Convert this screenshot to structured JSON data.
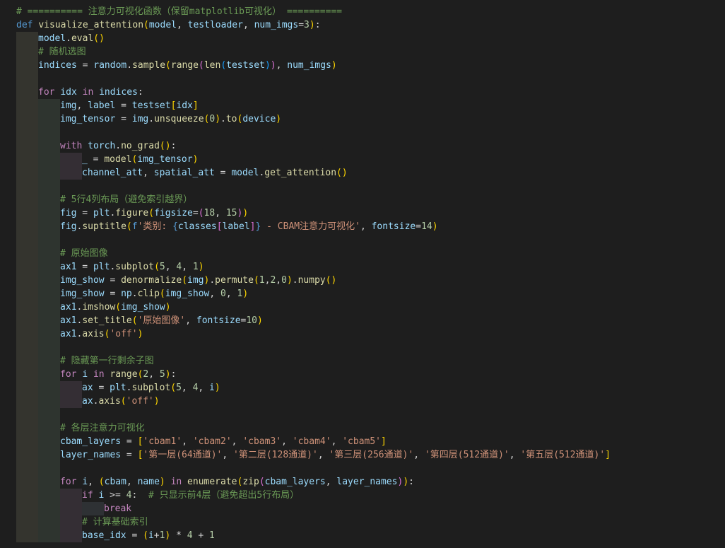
{
  "editor": {
    "theme": "dark",
    "background": "#1e1e1e",
    "language": "python"
  },
  "lines": [
    {
      "indent": 0,
      "tokens": [
        [
          "# ========== 注意力可视化函数（保留matplotlib可视化） ==========",
          "comment"
        ]
      ]
    },
    {
      "indent": 0,
      "tokens": [
        [
          "def",
          "kw"
        ],
        [
          " ",
          "op"
        ],
        [
          "visualize_attention",
          "fn"
        ],
        [
          "(",
          "b1"
        ],
        [
          "model",
          "var"
        ],
        [
          ", ",
          "op"
        ],
        [
          "testloader",
          "var"
        ],
        [
          ", ",
          "op"
        ],
        [
          "num_imgs",
          "var"
        ],
        [
          "=",
          "op"
        ],
        [
          "3",
          "num"
        ],
        [
          ")",
          "b1"
        ],
        [
          ":",
          "op"
        ]
      ]
    },
    {
      "indent": 1,
      "tokens": [
        [
          "model",
          "var"
        ],
        [
          ".",
          "op"
        ],
        [
          "eval",
          "fn"
        ],
        [
          "()",
          "b1"
        ]
      ]
    },
    {
      "indent": 1,
      "tokens": [
        [
          "# 随机选图",
          "comment"
        ]
      ]
    },
    {
      "indent": 1,
      "tokens": [
        [
          "indices",
          "var"
        ],
        [
          " = ",
          "op"
        ],
        [
          "random",
          "var"
        ],
        [
          ".",
          "op"
        ],
        [
          "sample",
          "fn"
        ],
        [
          "(",
          "b1"
        ],
        [
          "range",
          "fn"
        ],
        [
          "(",
          "b2"
        ],
        [
          "len",
          "fn"
        ],
        [
          "(",
          "b3"
        ],
        [
          "testset",
          "var"
        ],
        [
          ")",
          "b3"
        ],
        [
          ")",
          "b2"
        ],
        [
          ", ",
          "op"
        ],
        [
          "num_imgs",
          "var"
        ],
        [
          ")",
          "b1"
        ]
      ]
    },
    {
      "indent": 1,
      "tokens": []
    },
    {
      "indent": 1,
      "tokens": [
        [
          "for",
          "ctrl"
        ],
        [
          " ",
          "op"
        ],
        [
          "idx",
          "var"
        ],
        [
          " ",
          "op"
        ],
        [
          "in",
          "ctrl"
        ],
        [
          " ",
          "op"
        ],
        [
          "indices",
          "var"
        ],
        [
          ":",
          "op"
        ]
      ]
    },
    {
      "indent": 2,
      "tokens": [
        [
          "img",
          "var"
        ],
        [
          ", ",
          "op"
        ],
        [
          "label",
          "var"
        ],
        [
          " = ",
          "op"
        ],
        [
          "testset",
          "var"
        ],
        [
          "[",
          "b1"
        ],
        [
          "idx",
          "var"
        ],
        [
          "]",
          "b1"
        ]
      ]
    },
    {
      "indent": 2,
      "tokens": [
        [
          "img_tensor",
          "var"
        ],
        [
          " = ",
          "op"
        ],
        [
          "img",
          "var"
        ],
        [
          ".",
          "op"
        ],
        [
          "unsqueeze",
          "fn"
        ],
        [
          "(",
          "b1"
        ],
        [
          "0",
          "num"
        ],
        [
          ")",
          "b1"
        ],
        [
          ".",
          "op"
        ],
        [
          "to",
          "fn"
        ],
        [
          "(",
          "b1"
        ],
        [
          "device",
          "var"
        ],
        [
          ")",
          "b1"
        ]
      ]
    },
    {
      "indent": 2,
      "tokens": []
    },
    {
      "indent": 2,
      "tokens": [
        [
          "with",
          "ctrl"
        ],
        [
          " ",
          "op"
        ],
        [
          "torch",
          "var"
        ],
        [
          ".",
          "op"
        ],
        [
          "no_grad",
          "fn"
        ],
        [
          "()",
          "b1"
        ],
        [
          ":",
          "op"
        ]
      ]
    },
    {
      "indent": 3,
      "tokens": [
        [
          "_",
          "var"
        ],
        [
          " = ",
          "op"
        ],
        [
          "model",
          "fn"
        ],
        [
          "(",
          "b1"
        ],
        [
          "img_tensor",
          "var"
        ],
        [
          ")",
          "b1"
        ]
      ]
    },
    {
      "indent": 3,
      "tokens": [
        [
          "channel_att",
          "var"
        ],
        [
          ", ",
          "op"
        ],
        [
          "spatial_att",
          "var"
        ],
        [
          " = ",
          "op"
        ],
        [
          "model",
          "var"
        ],
        [
          ".",
          "op"
        ],
        [
          "get_attention",
          "fn"
        ],
        [
          "()",
          "b1"
        ]
      ]
    },
    {
      "indent": 2,
      "tokens": []
    },
    {
      "indent": 2,
      "tokens": [
        [
          "# 5行4列布局（避免索引越界）",
          "comment"
        ]
      ]
    },
    {
      "indent": 2,
      "tokens": [
        [
          "fig",
          "var"
        ],
        [
          " = ",
          "op"
        ],
        [
          "plt",
          "var"
        ],
        [
          ".",
          "op"
        ],
        [
          "figure",
          "fn"
        ],
        [
          "(",
          "b1"
        ],
        [
          "figsize",
          "var"
        ],
        [
          "=",
          "op"
        ],
        [
          "(",
          "b2"
        ],
        [
          "18",
          "num"
        ],
        [
          ", ",
          "op"
        ],
        [
          "15",
          "num"
        ],
        [
          ")",
          "b2"
        ],
        [
          ")",
          "b1"
        ]
      ]
    },
    {
      "indent": 2,
      "tokens": [
        [
          "fig",
          "var"
        ],
        [
          ".",
          "op"
        ],
        [
          "suptitle",
          "fn"
        ],
        [
          "(",
          "b1"
        ],
        [
          "f",
          "fs"
        ],
        [
          "'类别: ",
          "str"
        ],
        [
          "{",
          "kw"
        ],
        [
          "classes",
          "var"
        ],
        [
          "[",
          "b2"
        ],
        [
          "label",
          "var"
        ],
        [
          "]",
          "b2"
        ],
        [
          "}",
          "kw"
        ],
        [
          " - CBAM注意力可视化'",
          "str"
        ],
        [
          ", ",
          "op"
        ],
        [
          "fontsize",
          "var"
        ],
        [
          "=",
          "op"
        ],
        [
          "14",
          "num"
        ],
        [
          ")",
          "b1"
        ]
      ]
    },
    {
      "indent": 2,
      "tokens": []
    },
    {
      "indent": 2,
      "tokens": [
        [
          "# 原始图像",
          "comment"
        ]
      ]
    },
    {
      "indent": 2,
      "tokens": [
        [
          "ax1",
          "var"
        ],
        [
          " = ",
          "op"
        ],
        [
          "plt",
          "var"
        ],
        [
          ".",
          "op"
        ],
        [
          "subplot",
          "fn"
        ],
        [
          "(",
          "b1"
        ],
        [
          "5",
          "num"
        ],
        [
          ", ",
          "op"
        ],
        [
          "4",
          "num"
        ],
        [
          ", ",
          "op"
        ],
        [
          "1",
          "num"
        ],
        [
          ")",
          "b1"
        ]
      ]
    },
    {
      "indent": 2,
      "tokens": [
        [
          "img_show",
          "var"
        ],
        [
          " = ",
          "op"
        ],
        [
          "denormalize",
          "fn"
        ],
        [
          "(",
          "b1"
        ],
        [
          "img",
          "var"
        ],
        [
          ")",
          "b1"
        ],
        [
          ".",
          "op"
        ],
        [
          "permute",
          "fn"
        ],
        [
          "(",
          "b1"
        ],
        [
          "1",
          "num"
        ],
        [
          ",",
          "op"
        ],
        [
          "2",
          "num"
        ],
        [
          ",",
          "op"
        ],
        [
          "0",
          "num"
        ],
        [
          ")",
          "b1"
        ],
        [
          ".",
          "op"
        ],
        [
          "numpy",
          "fn"
        ],
        [
          "()",
          "b1"
        ]
      ]
    },
    {
      "indent": 2,
      "tokens": [
        [
          "img_show",
          "var"
        ],
        [
          " = ",
          "op"
        ],
        [
          "np",
          "var"
        ],
        [
          ".",
          "op"
        ],
        [
          "clip",
          "fn"
        ],
        [
          "(",
          "b1"
        ],
        [
          "img_show",
          "var"
        ],
        [
          ", ",
          "op"
        ],
        [
          "0",
          "num"
        ],
        [
          ", ",
          "op"
        ],
        [
          "1",
          "num"
        ],
        [
          ")",
          "b1"
        ]
      ]
    },
    {
      "indent": 2,
      "tokens": [
        [
          "ax1",
          "var"
        ],
        [
          ".",
          "op"
        ],
        [
          "imshow",
          "fn"
        ],
        [
          "(",
          "b1"
        ],
        [
          "img_show",
          "var"
        ],
        [
          ")",
          "b1"
        ]
      ]
    },
    {
      "indent": 2,
      "tokens": [
        [
          "ax1",
          "var"
        ],
        [
          ".",
          "op"
        ],
        [
          "set_title",
          "fn"
        ],
        [
          "(",
          "b1"
        ],
        [
          "'原始图像'",
          "str"
        ],
        [
          ", ",
          "op"
        ],
        [
          "fontsize",
          "var"
        ],
        [
          "=",
          "op"
        ],
        [
          "10",
          "num"
        ],
        [
          ")",
          "b1"
        ]
      ]
    },
    {
      "indent": 2,
      "tokens": [
        [
          "ax1",
          "var"
        ],
        [
          ".",
          "op"
        ],
        [
          "axis",
          "fn"
        ],
        [
          "(",
          "b1"
        ],
        [
          "'off'",
          "str"
        ],
        [
          ")",
          "b1"
        ]
      ]
    },
    {
      "indent": 2,
      "tokens": []
    },
    {
      "indent": 2,
      "tokens": [
        [
          "# 隐藏第一行剩余子图",
          "comment"
        ]
      ]
    },
    {
      "indent": 2,
      "tokens": [
        [
          "for",
          "ctrl"
        ],
        [
          " ",
          "op"
        ],
        [
          "i",
          "var"
        ],
        [
          " ",
          "op"
        ],
        [
          "in",
          "ctrl"
        ],
        [
          " ",
          "op"
        ],
        [
          "range",
          "fn"
        ],
        [
          "(",
          "b1"
        ],
        [
          "2",
          "num"
        ],
        [
          ", ",
          "op"
        ],
        [
          "5",
          "num"
        ],
        [
          ")",
          "b1"
        ],
        [
          ":",
          "op"
        ]
      ]
    },
    {
      "indent": 3,
      "tokens": [
        [
          "ax",
          "var"
        ],
        [
          " = ",
          "op"
        ],
        [
          "plt",
          "var"
        ],
        [
          ".",
          "op"
        ],
        [
          "subplot",
          "fn"
        ],
        [
          "(",
          "b1"
        ],
        [
          "5",
          "num"
        ],
        [
          ", ",
          "op"
        ],
        [
          "4",
          "num"
        ],
        [
          ", ",
          "op"
        ],
        [
          "i",
          "var"
        ],
        [
          ")",
          "b1"
        ]
      ]
    },
    {
      "indent": 3,
      "tokens": [
        [
          "ax",
          "var"
        ],
        [
          ".",
          "op"
        ],
        [
          "axis",
          "fn"
        ],
        [
          "(",
          "b1"
        ],
        [
          "'off'",
          "str"
        ],
        [
          ")",
          "b1"
        ]
      ]
    },
    {
      "indent": 2,
      "tokens": []
    },
    {
      "indent": 2,
      "tokens": [
        [
          "# 各层注意力可视化",
          "comment"
        ]
      ]
    },
    {
      "indent": 2,
      "tokens": [
        [
          "cbam_layers",
          "var"
        ],
        [
          " = ",
          "op"
        ],
        [
          "[",
          "b1"
        ],
        [
          "'cbam1'",
          "str"
        ],
        [
          ", ",
          "op"
        ],
        [
          "'cbam2'",
          "str"
        ],
        [
          ", ",
          "op"
        ],
        [
          "'cbam3'",
          "str"
        ],
        [
          ", ",
          "op"
        ],
        [
          "'cbam4'",
          "str"
        ],
        [
          ", ",
          "op"
        ],
        [
          "'cbam5'",
          "str"
        ],
        [
          "]",
          "b1"
        ]
      ]
    },
    {
      "indent": 2,
      "tokens": [
        [
          "layer_names",
          "var"
        ],
        [
          " = ",
          "op"
        ],
        [
          "[",
          "b1"
        ],
        [
          "'第一层(64通道)'",
          "str"
        ],
        [
          ", ",
          "op"
        ],
        [
          "'第二层(128通道)'",
          "str"
        ],
        [
          ", ",
          "op"
        ],
        [
          "'第三层(256通道)'",
          "str"
        ],
        [
          ", ",
          "op"
        ],
        [
          "'第四层(512通道)'",
          "str"
        ],
        [
          ", ",
          "op"
        ],
        [
          "'第五层(512通道)'",
          "str"
        ],
        [
          "]",
          "b1"
        ]
      ]
    },
    {
      "indent": 2,
      "tokens": []
    },
    {
      "indent": 2,
      "tokens": [
        [
          "for",
          "ctrl"
        ],
        [
          " ",
          "op"
        ],
        [
          "i",
          "var"
        ],
        [
          ", ",
          "op"
        ],
        [
          "(",
          "b1"
        ],
        [
          "cbam",
          "var"
        ],
        [
          ", ",
          "op"
        ],
        [
          "name",
          "var"
        ],
        [
          ")",
          "b1"
        ],
        [
          " ",
          "op"
        ],
        [
          "in",
          "ctrl"
        ],
        [
          " ",
          "op"
        ],
        [
          "enumerate",
          "fn"
        ],
        [
          "(",
          "b1"
        ],
        [
          "zip",
          "fn"
        ],
        [
          "(",
          "b2"
        ],
        [
          "cbam_layers",
          "var"
        ],
        [
          ", ",
          "op"
        ],
        [
          "layer_names",
          "var"
        ],
        [
          ")",
          "b2"
        ],
        [
          ")",
          "b1"
        ],
        [
          ":",
          "op"
        ]
      ]
    },
    {
      "indent": 3,
      "tokens": [
        [
          "if",
          "ctrl"
        ],
        [
          " ",
          "op"
        ],
        [
          "i",
          "var"
        ],
        [
          " >= ",
          "op"
        ],
        [
          "4",
          "num"
        ],
        [
          ":  ",
          "op"
        ],
        [
          "# 只显示前4层（避免超出5行布局）",
          "comment"
        ]
      ]
    },
    {
      "indent": 4,
      "tokens": [
        [
          "break",
          "ctrl"
        ]
      ]
    },
    {
      "indent": 3,
      "tokens": [
        [
          "# 计算基础索引",
          "comment"
        ]
      ]
    },
    {
      "indent": 3,
      "tokens": [
        [
          "base_idx",
          "var"
        ],
        [
          " = ",
          "op"
        ],
        [
          "(",
          "b1"
        ],
        [
          "i",
          "var"
        ],
        [
          "+",
          "op"
        ],
        [
          "1",
          "num"
        ],
        [
          ")",
          "b1"
        ],
        [
          " * ",
          "op"
        ],
        [
          "4",
          "num"
        ],
        [
          " + ",
          "op"
        ],
        [
          "1",
          "num"
        ]
      ]
    }
  ]
}
